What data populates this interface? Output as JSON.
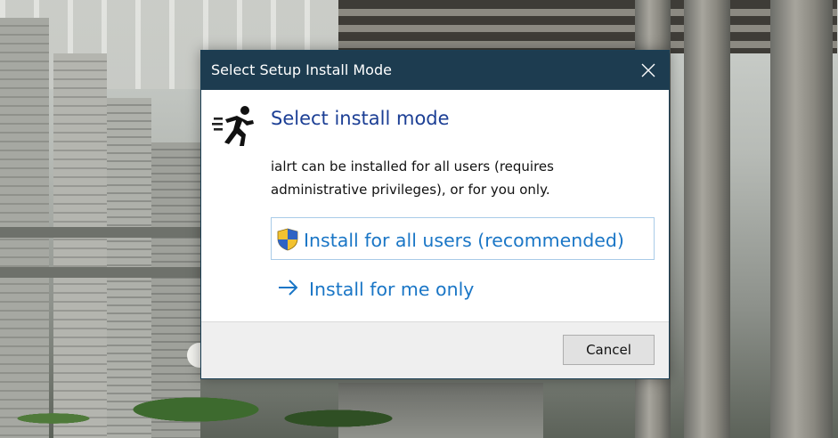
{
  "window": {
    "title": "Select Setup Install Mode",
    "close_icon": "close-icon"
  },
  "content": {
    "heading": "Select install mode",
    "header_icon": "running-man-icon",
    "description": "ialrt can be installed for all users (requires administrative privileges), or for you only."
  },
  "options": {
    "all_users": {
      "label": "Install for all users (recommended)",
      "icon": "uac-shield-icon"
    },
    "me_only": {
      "label": "Install for me only",
      "icon": "arrow-right-icon"
    }
  },
  "footer": {
    "cancel_label": "Cancel"
  },
  "colors": {
    "titlebar": "#1d3c50",
    "heading": "#1c3f95",
    "link": "#1a76c6",
    "selected_border": "#a9cbe8",
    "footer": "#efefef"
  }
}
